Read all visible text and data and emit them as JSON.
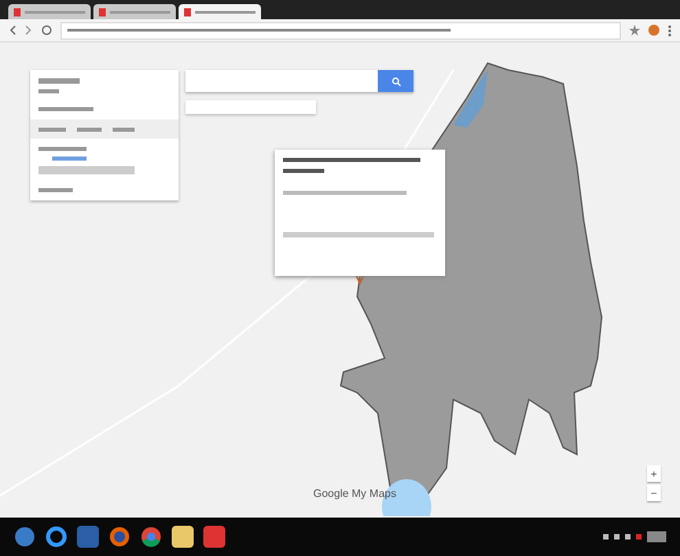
{
  "browser": {
    "tabs": [
      {
        "selected": false
      },
      {
        "selected": false
      },
      {
        "selected": true
      }
    ]
  },
  "map": {
    "attribution": "Google My Maps",
    "zoom_controls": [
      "+",
      "−"
    ]
  }
}
